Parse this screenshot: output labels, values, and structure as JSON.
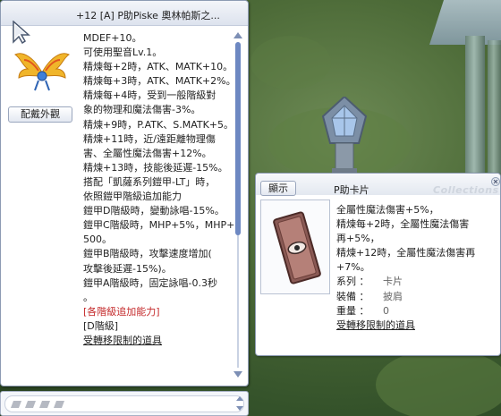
{
  "item": {
    "title": "+12 [A] P助Piske 奧林帕斯之...",
    "preview_button": "配戴外觀",
    "description": [
      {
        "text": "MDEF+10。"
      },
      {
        "text": "可使用聖音Lv.1。"
      },
      {
        "text": "精煉每+2時，ATK、MATK+10。"
      },
      {
        "text": "精煉每+3時，ATK、MATK+2%。"
      },
      {
        "text": "精煉每+4時，受到一般階級對"
      },
      {
        "text": "象的物理和魔法傷害-3%。"
      },
      {
        "text": "精煉+9時，P.ATK、S.MATK+5。"
      },
      {
        "text": "精煉+11時，近/遠距離物理傷"
      },
      {
        "text": "害、全屬性魔法傷害+12%。"
      },
      {
        "text": "精煉+13時，技能後延遲-15%。"
      },
      {
        "text": "搭配「凱薩系列鎧甲-LT」時，"
      },
      {
        "text": "依照鎧甲階級追加能力"
      },
      {
        "text": "鎧甲D階級時，變動詠唱-15%。"
      },
      {
        "text": "鎧甲C階級時，MHP+5%，MHP+2"
      },
      {
        "text": "500。"
      },
      {
        "text": "鎧甲B階級時，攻擊速度增加("
      },
      {
        "text": "攻擊後延遲-15%)。"
      },
      {
        "text": "鎧甲A階級時，固定詠唱-0.3秒"
      },
      {
        "text": "。"
      },
      {
        "text": "[各階級追加能力]",
        "style": "red"
      },
      {
        "text": "[D階級]"
      },
      {
        "text": "受轉移限制的道具",
        "style": "link"
      }
    ]
  },
  "card": {
    "view_button": "顯示",
    "title": "P助卡片",
    "watermark": "Collections",
    "description": [
      "全屬性魔法傷害+5%，",
      "精煉每+2時，全屬性魔法傷害",
      "再+5%，",
      "精煉+12時，全屬性魔法傷害再",
      "+7%。"
    ],
    "properties": [
      {
        "label": "系列 ：",
        "value": "卡片"
      },
      {
        "label": "裝備 ：",
        "value": "披肩"
      },
      {
        "label": "重量 ：",
        "value": "0"
      }
    ],
    "transfer_note": "受轉移限制的道具"
  },
  "colors": {
    "window_border": "#8d9bb3",
    "scrollbar_thumb": "#6d88c2",
    "red_text": "#c4292a"
  },
  "icons": {
    "cursor": "arrow-cursor-icon",
    "item": "wing-icon",
    "card": "card-icon",
    "close": "close-icon"
  }
}
